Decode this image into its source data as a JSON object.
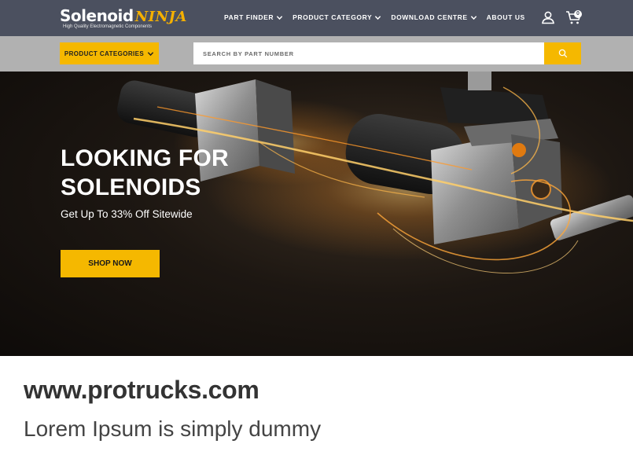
{
  "header": {
    "logo_main": "Solenoid",
    "logo_accent": "NINJA",
    "logo_tagline": "High Quality Electromagnetic Components",
    "nav": [
      {
        "label": "PART FINDER",
        "dropdown": true
      },
      {
        "label": "PRODUCT CATEGORY",
        "dropdown": true
      },
      {
        "label": "DOWNLOAD CENTRE",
        "dropdown": true
      },
      {
        "label": "ABOUT US",
        "dropdown": false
      }
    ],
    "cart_count": "0"
  },
  "search": {
    "categories_label": "PRODUCT CATEGORIES",
    "placeholder": "SEARCH BY PART NUMBER"
  },
  "hero": {
    "title_line1": "LOOKING FOR",
    "title_line2": "SOLENOIDS",
    "subtitle": "Get Up To 33% Off Sitewide",
    "cta_label": "SHOP NOW"
  },
  "caption": {
    "title": "www.protrucks.com",
    "subtitle": "Lorem Ipsum is simply dummy"
  },
  "colors": {
    "accent": "#f5b800",
    "nav_bg": "#4b505f",
    "search_row_bg": "#b1b1b1"
  },
  "icons": [
    "chevron-down-icon",
    "user-icon",
    "cart-icon",
    "search-icon"
  ]
}
